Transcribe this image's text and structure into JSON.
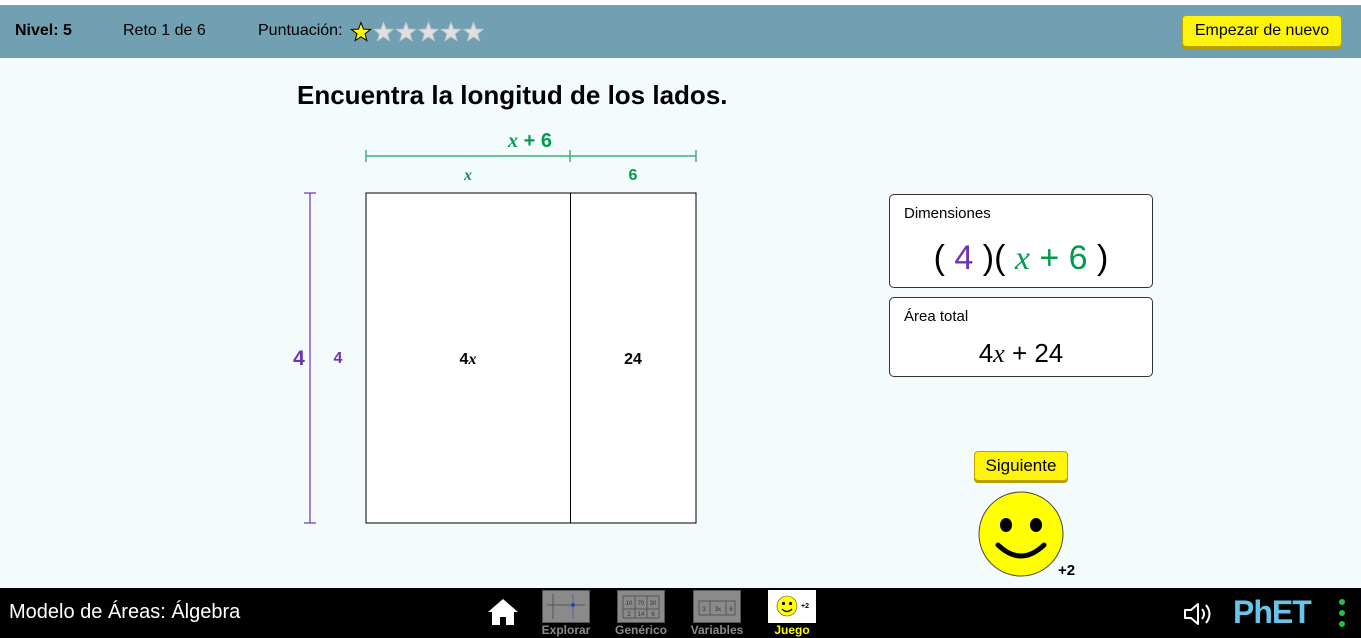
{
  "status_bar": {
    "level": "Nivel: 5",
    "challenge": "Reto 1 de 6",
    "score_label": "Puntuación:",
    "score_stars": {
      "filled": 1,
      "total": 6,
      "icon": "star-icon"
    },
    "reset_label": "Empezar de nuevo"
  },
  "challenge": {
    "title": "Encuentra la longitud de los lados.",
    "top_total": {
      "var": "x",
      "rest": " + 6"
    },
    "top_parts": [
      "x",
      "6"
    ],
    "left_total": "4",
    "left_parts": [
      "4"
    ],
    "cells": {
      "left": {
        "num": "4",
        "var": "x"
      },
      "right": "24"
    }
  },
  "dimensions_panel": {
    "label": "Dimensiones",
    "open1": "( ",
    "factor1": "4",
    "mid": " )( ",
    "factor2_var": "x",
    "factor2_rest": " + 6",
    "close": " )"
  },
  "area_panel": {
    "label": "Área total",
    "num": "4",
    "var": "x",
    "rest": " + 24"
  },
  "feedback": {
    "next_label": "Siguiente",
    "points": "+2",
    "face": "smiley-face-icon"
  },
  "navbar": {
    "sim_title": "Modelo de Áreas: Álgebra",
    "screens": [
      {
        "label": "Explorar",
        "active": false
      },
      {
        "label": "Genérico",
        "active": false
      },
      {
        "label": "Variables",
        "active": false
      },
      {
        "label": "Juego",
        "active": true
      }
    ],
    "game_thumb_badge": "+2",
    "generic_thumb": [
      "10",
      "70",
      "30",
      "2",
      "14",
      "6"
    ],
    "variables_thumb": [
      "3",
      "3x",
      "6"
    ],
    "logo": "PhET"
  },
  "colors": {
    "statusbar": "#71a0b3",
    "background": "#f4fbfd",
    "button_yellow": "#fef30a",
    "horizontal_dimension": "#009b4e",
    "vertical_dimension": "#6a32b8"
  }
}
